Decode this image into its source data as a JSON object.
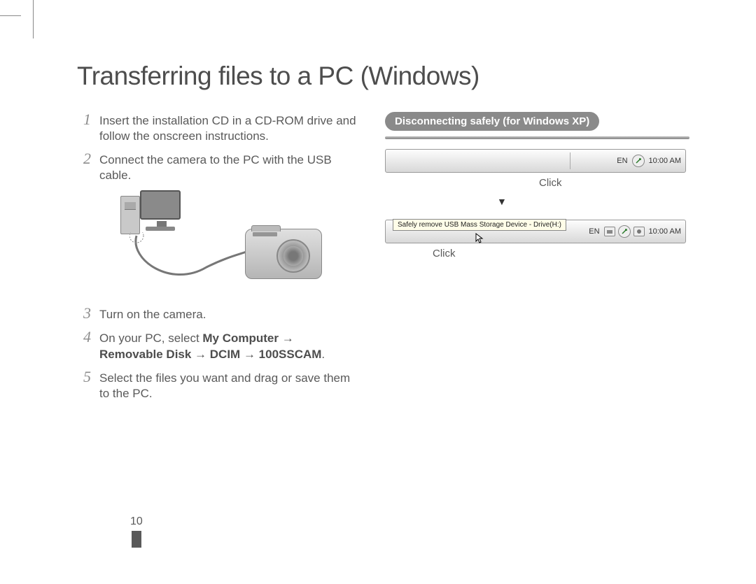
{
  "page": {
    "title": "Transferring files to a PC (Windows)",
    "number": "10"
  },
  "steps": {
    "s1": {
      "num": "1",
      "text": "Insert the installation CD in a CD-ROM drive and follow the onscreen instructions."
    },
    "s2": {
      "num": "2",
      "text": "Connect the camera to the PC with the USB cable."
    },
    "s3": {
      "num": "3",
      "text": "Turn on the camera."
    },
    "s4": {
      "num": "4",
      "prefix": "On your PC, select ",
      "bold": "My Computer → Removable Disk → DCIM → 100SSCAM",
      "suffix": "."
    },
    "s5": {
      "num": "5",
      "text": "Select the files you want and drag or save them to the PC."
    }
  },
  "right": {
    "pill": "Disconnecting safely (for Windows XP)",
    "taskbar1": {
      "lang": "EN",
      "time": "10:00 AM",
      "click": "Click"
    },
    "arrow": "▼",
    "taskbar2": {
      "tooltip": "Safely remove USB Mass Storage Device - Drive(H:)",
      "lang": "EN",
      "time": "10:00 AM",
      "click": "Click"
    }
  }
}
